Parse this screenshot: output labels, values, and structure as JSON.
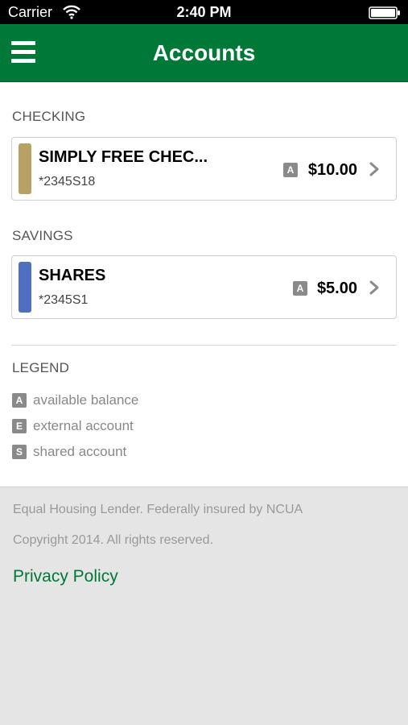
{
  "status_bar": {
    "carrier": "Carrier",
    "time": "2:40 PM",
    "wifi_icon": "wifi-icon",
    "battery_icon": "battery-icon"
  },
  "nav": {
    "title": "Accounts",
    "menu_icon": "hamburger-menu-icon",
    "background_color": "#007838"
  },
  "checking": {
    "label": "CHECKING",
    "account": {
      "name": "SIMPLY FREE CHEC...",
      "number": "*2345S18",
      "badge": "A",
      "balance": "$10.00",
      "color": "#b5a264"
    }
  },
  "savings": {
    "label": "SAVINGS",
    "account": {
      "name": "SHARES",
      "number": "*2345S1",
      "badge": "A",
      "balance": "$5.00",
      "color": "#4f6fc0"
    }
  },
  "legend": {
    "label": "LEGEND",
    "items": [
      {
        "badge": "A",
        "text": "available balance"
      },
      {
        "badge": "E",
        "text": "external account"
      },
      {
        "badge": "S",
        "text": "shared account"
      }
    ]
  },
  "footer": {
    "line1": "Equal Housing Lender. Federally insured by NCUA",
    "line2": "Copyright 2014. All rights reserved.",
    "privacy_link": "Privacy Policy"
  }
}
